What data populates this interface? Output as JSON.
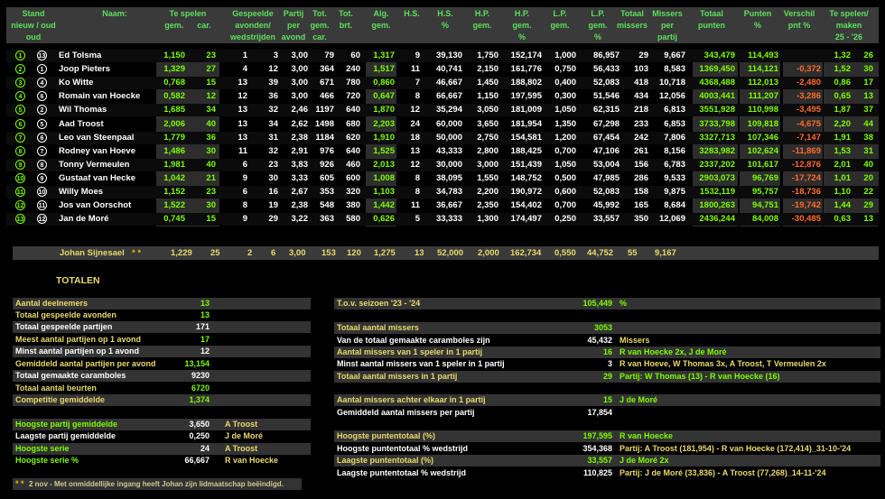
{
  "header": {
    "stand": "Stand\nnieuw / oud\noud",
    "naam": "Naam:",
    "te_spelen": "Te spelen\ngem.      car.",
    "gespeelde": "Gespeelde\navonden/\nwedstrijden",
    "partij": "Partij\nper\navond",
    "tot_gem": "Tot.\ngem.\ncar.",
    "tot_brt": "Tot.\nbrt.",
    "alg": "Alg.\ngem.",
    "hs": "H.S.",
    "hs_pct": "H.S.\n%",
    "hp_gem": "H.P.\ngem.",
    "hp_pct": "H.P.\ngem.\n%",
    "lp_gem": "L.P.\ngem.",
    "lp_pct": "L.P.\ngem.\n%",
    "totaal_missers": "Totaal\nmissers",
    "missers_per": "Missers\nper\npartij",
    "totaal_punten": "Totaal\npunten",
    "punten_pct": "Punten\n%",
    "verschil": "Verschil\npnt %",
    "te_spelen_maken": "Te spelen/\nmaken\n25 - '26"
  },
  "players": [
    {
      "nieuw": "1",
      "oud": "13",
      "naam": "Ed Tolsma",
      "gem": "1,150",
      "car": "23",
      "av": "1",
      "wd": "3",
      "pa": "3,00",
      "totcar": "79",
      "brt": "60",
      "alg": "1,317",
      "hs": "9",
      "hspct": "39,130",
      "hp": "1,750",
      "hppct": "152,174",
      "lp": "1,000",
      "lppct": "86,957",
      "mis": "29",
      "misp": "9,667",
      "pnt": "343,479",
      "pntpct": "114,493",
      "ver": "",
      "tsp": "1,32",
      "tmk": "26"
    },
    {
      "nieuw": "2",
      "oud": "1",
      "naam": "Joop Pieters",
      "gem": "1,329",
      "car": "27",
      "av": "4",
      "wd": "12",
      "pa": "3,00",
      "totcar": "364",
      "brt": "240",
      "alg": "1,517",
      "hs": "11",
      "hspct": "40,741",
      "hp": "2,150",
      "hppct": "161,776",
      "lp": "0,750",
      "lppct": "56,433",
      "mis": "103",
      "misp": "8,583",
      "pnt": "1369,450",
      "pntpct": "114,121",
      "ver": "-0,372",
      "tsp": "1,52",
      "tmk": "30"
    },
    {
      "nieuw": "3",
      "oud": "4",
      "naam": "Ko Witte",
      "gem": "0,768",
      "car": "15",
      "av": "13",
      "wd": "39",
      "pa": "3,00",
      "totcar": "671",
      "brt": "780",
      "alg": "0,860",
      "hs": "7",
      "hspct": "46,667",
      "hp": "1,450",
      "hppct": "188,802",
      "lp": "0,400",
      "lppct": "52,083",
      "mis": "418",
      "misp": "10,718",
      "pnt": "4368,488",
      "pntpct": "112,013",
      "ver": "-2,480",
      "tsp": "0,86",
      "tmk": "17"
    },
    {
      "nieuw": "4",
      "oud": "6",
      "naam": "Romain van Hoecke",
      "gem": "0,582",
      "car": "12",
      "av": "12",
      "wd": "36",
      "pa": "3,00",
      "totcar": "466",
      "brt": "720",
      "alg": "0,647",
      "hs": "8",
      "hspct": "66,667",
      "hp": "1,150",
      "hppct": "197,595",
      "lp": "0,300",
      "lppct": "51,546",
      "mis": "434",
      "misp": "12,056",
      "pnt": "4003,441",
      "pntpct": "111,207",
      "ver": "-3,286",
      "tsp": "0,65",
      "tmk": "13"
    },
    {
      "nieuw": "5",
      "oud": "2",
      "naam": "Wil Thomas",
      "gem": "1,685",
      "car": "34",
      "av": "13",
      "wd": "32",
      "pa": "2,46",
      "totcar": "1197",
      "brt": "640",
      "alg": "1,870",
      "hs": "12",
      "hspct": "35,294",
      "hp": "3,050",
      "hppct": "181,009",
      "lp": "1,050",
      "lppct": "62,315",
      "mis": "218",
      "misp": "6,813",
      "pnt": "3551,928",
      "pntpct": "110,998",
      "ver": "-3,495",
      "tsp": "1,87",
      "tmk": "37"
    },
    {
      "nieuw": "6",
      "oud": "5",
      "naam": "Aad Troost",
      "gem": "2,006",
      "car": "40",
      "av": "13",
      "wd": "34",
      "pa": "2,62",
      "totcar": "1498",
      "brt": "680",
      "alg": "2,203",
      "hs": "24",
      "hspct": "60,000",
      "hp": "3,650",
      "hppct": "181,954",
      "lp": "1,350",
      "lppct": "67,298",
      "mis": "233",
      "misp": "6,853",
      "pnt": "3733,798",
      "pntpct": "109,818",
      "ver": "-4,675",
      "tsp": "2,20",
      "tmk": "44"
    },
    {
      "nieuw": "7",
      "oud": "6",
      "naam": "Leo van Steenpaal",
      "gem": "1,779",
      "car": "36",
      "av": "13",
      "wd": "31",
      "pa": "2,38",
      "totcar": "1184",
      "brt": "620",
      "alg": "1,910",
      "hs": "18",
      "hspct": "50,000",
      "hp": "2,750",
      "hppct": "154,581",
      "lp": "1,200",
      "lppct": "67,454",
      "mis": "242",
      "misp": "7,806",
      "pnt": "3327,713",
      "pntpct": "107,346",
      "ver": "-7,147",
      "tsp": "1,91",
      "tmk": "38"
    },
    {
      "nieuw": "8",
      "oud": "7",
      "naam": "Rodney van Hoeve",
      "gem": "1,486",
      "car": "30",
      "av": "11",
      "wd": "32",
      "pa": "2,91",
      "totcar": "976",
      "brt": "640",
      "alg": "1,525",
      "hs": "13",
      "hspct": "43,333",
      "hp": "2,800",
      "hppct": "188,425",
      "lp": "0,700",
      "lppct": "47,106",
      "mis": "261",
      "misp": "8,156",
      "pnt": "3283,982",
      "pntpct": "102,624",
      "ver": "-11,869",
      "tsp": "1,53",
      "tmk": "31"
    },
    {
      "nieuw": "9",
      "oud": "8",
      "naam": "Tonny Vermeulen",
      "gem": "1,981",
      "car": "40",
      "av": "6",
      "wd": "23",
      "pa": "3,83",
      "totcar": "926",
      "brt": "460",
      "alg": "2,013",
      "hs": "12",
      "hspct": "30,000",
      "hp": "3,000",
      "hppct": "151,439",
      "lp": "1,050",
      "lppct": "53,004",
      "mis": "156",
      "misp": "6,783",
      "pnt": "2337,202",
      "pntpct": "101,617",
      "ver": "-12,876",
      "tsp": "2,01",
      "tmk": "40"
    },
    {
      "nieuw": "10",
      "oud": "9",
      "naam": "Gustaaf van Hecke",
      "gem": "1,042",
      "car": "21",
      "av": "9",
      "wd": "30",
      "pa": "3,33",
      "totcar": "605",
      "brt": "600",
      "alg": "1,008",
      "hs": "8",
      "hspct": "38,095",
      "hp": "1,550",
      "hppct": "148,752",
      "lp": "0,500",
      "lppct": "47,985",
      "mis": "286",
      "misp": "9,533",
      "pnt": "2903,073",
      "pntpct": "96,769",
      "ver": "-17,724",
      "tsp": "1,01",
      "tmk": "20"
    },
    {
      "nieuw": "11",
      "oud": "10",
      "naam": "Willy Moes",
      "gem": "1,152",
      "car": "23",
      "av": "6",
      "wd": "16",
      "pa": "2,67",
      "totcar": "353",
      "brt": "320",
      "alg": "1,103",
      "hs": "8",
      "hspct": "34,783",
      "hp": "2,200",
      "hppct": "190,972",
      "lp": "0,600",
      "lppct": "52,083",
      "mis": "158",
      "misp": "9,875",
      "pnt": "1532,119",
      "pntpct": "95,757",
      "ver": "-18,736",
      "tsp": "1,10",
      "tmk": "22"
    },
    {
      "nieuw": "12",
      "oud": "11",
      "naam": "Jos van Oorschot",
      "gem": "1,522",
      "car": "30",
      "av": "8",
      "wd": "19",
      "pa": "2,38",
      "totcar": "548",
      "brt": "380",
      "alg": "1,442",
      "hs": "11",
      "hspct": "36,667",
      "hp": "2,350",
      "hppct": "154,402",
      "lp": "0,700",
      "lppct": "45,992",
      "mis": "165",
      "misp": "8,684",
      "pnt": "1800,263",
      "pntpct": "94,751",
      "ver": "-19,742",
      "tsp": "1,44",
      "tmk": "29"
    },
    {
      "nieuw": "13",
      "oud": "12",
      "naam": "Jan de Moré",
      "gem": "0,745",
      "car": "15",
      "av": "9",
      "wd": "29",
      "pa": "3,22",
      "totcar": "363",
      "brt": "580",
      "alg": "0,626",
      "hs": "5",
      "hspct": "33,333",
      "hp": "1,300",
      "hppct": "174,497",
      "lp": "0,250",
      "lppct": "33,557",
      "mis": "350",
      "misp": "12,069",
      "pnt": "2436,244",
      "pntpct": "84,008",
      "ver": "-30,485",
      "tsp": "0,63",
      "tmk": "13"
    }
  ],
  "johan": {
    "naam": "Johan Sijnesael",
    "stars": "* *",
    "gem": "1,229",
    "car": "25",
    "av": "2",
    "wd": "6",
    "pa": "3,00",
    "totcar": "153",
    "brt": "120",
    "alg": "1,275",
    "hs": "13",
    "hspct": "52,000",
    "hp": "2,000",
    "hppct": "162,734",
    "lp": "0,550",
    "lppct": "44,752",
    "mis": "55",
    "misp": "9,167"
  },
  "totalen": {
    "title": "TOTALEN",
    "left": [
      {
        "label": "Aantal deelnemers",
        "value": "13",
        "extra": ""
      },
      {
        "label": "Totaal gespeelde avonden",
        "value": "13",
        "extra": ""
      },
      {
        "label": "Totaal gespeelde partijen",
        "value": "171",
        "extra": ""
      },
      {
        "label": "Meest aantal partijen op 1 avond",
        "value": "17",
        "extra": ""
      },
      {
        "label": "Minst aantal partijen op 1 avond",
        "value": "12",
        "extra": ""
      },
      {
        "label": "Gemiddeld aantal partijen per avond",
        "value": "13,154",
        "extra": ""
      },
      {
        "label": "Totaal gemaakte caramboles",
        "value": "9230",
        "extra": ""
      },
      {
        "label": "Totaal aantal beurten",
        "value": "6720",
        "extra": ""
      },
      {
        "label": "Competitie gemiddelde",
        "value": "1,374",
        "extra": ""
      },
      {
        "label": "Hoogste partij gemiddelde",
        "value": "3,650",
        "extra": "A Troost"
      },
      {
        "label": "Laagste partij gemiddelde",
        "value": "0,250",
        "extra": "J de Moré"
      },
      {
        "label": "Hoogste serie",
        "value": "24",
        "extra": "A Troost"
      },
      {
        "label": "Hoogste serie %",
        "value": "66,667",
        "extra": "R van Hoecke"
      }
    ],
    "right": [
      {
        "label": "T.o.v. seizoen '23 - '24",
        "value": "105,449",
        "extra": "%"
      },
      {
        "label": "Totaal aantal missers",
        "value": "3053",
        "extra": ""
      },
      {
        "label": "Van de totaal gemaakte caramboles zijn",
        "value": "45,432",
        "extra": "Missers"
      },
      {
        "label": "Aantal missers van 1 speler in 1 partij",
        "value": "16",
        "extra": "R van Hoecke 2x, J de Moré"
      },
      {
        "label": "Minst aantal missers van 1 speler in 1 partij",
        "value": "3",
        "extra": "R van Hoeve, W Thomas 3x, A Troost, T Vermeulen 2x"
      },
      {
        "label": "Totaal aantal missers in 1 partij",
        "value": "29",
        "extra": "Partij: W Thomas (13) - R van Hoecke (16)"
      },
      {
        "label": "Aantal missers achter elkaar in 1 partij",
        "value": "15",
        "extra": "J de Moré"
      },
      {
        "label": "Gemiddeld aantal missers per partij",
        "value": "17,854",
        "extra": ""
      },
      {
        "label": "Hoogste puntentotaal (%)",
        "value": "197,595",
        "extra": "R van Hoecke"
      },
      {
        "label": "Hoogste puntentotaal % wedstrijd",
        "value": "354,368",
        "extra": "Partij: A Troost (181,954) - R van Hoecke (172,414)_31-10-'24"
      },
      {
        "label": "Laagste puntentotaal (%)",
        "value": "33,557",
        "extra": "J de Moré 2x"
      },
      {
        "label": "Laagste puntentotaal % wedstrijd",
        "value": "110,825",
        "extra": "Partij: J de Moré (33,836) - A Troost (77,268)_14-11-'24"
      }
    ],
    "footnote_stars": "* *",
    "footnote": "2 nov - Met onmiddellijke ingang heeft Johan zijn lidmaatschap beëindigd."
  }
}
